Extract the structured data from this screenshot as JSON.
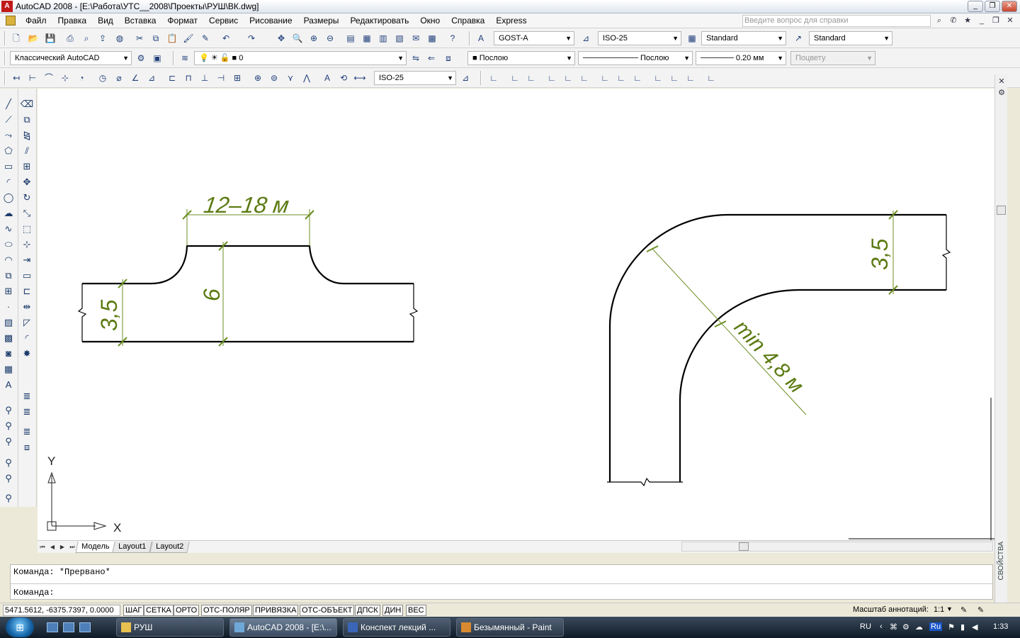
{
  "window": {
    "app_icon": "A",
    "title": "AutoCAD 2008 - [E:\\Работа\\УТС__2008\\Проекты\\РУШ\\ВК.dwg]",
    "controls": [
      "minimize-icon",
      "restore-icon",
      "close-icon"
    ]
  },
  "menubar": {
    "items": [
      "Файл",
      "Правка",
      "Вид",
      "Вставка",
      "Формат",
      "Сервис",
      "Рисование",
      "Размеры",
      "Редактировать",
      "Окно",
      "Справка",
      "Express"
    ],
    "help_placeholder": "Введите вопрос для справки"
  },
  "toolbar_styles": {
    "text_style": "GOST-A",
    "dim_style": "ISO-25",
    "table_style": "Standard",
    "mleader_style": "Standard"
  },
  "toolbar_layers": {
    "workspace": "Классический AutoCAD",
    "layer": "0",
    "color": "Послою",
    "linetype": "Послою",
    "lineweight": "0.20 мм",
    "plotstyle": "Поцвету"
  },
  "toolbar_dims": {
    "dim_style": "ISO-25"
  },
  "drawing": {
    "ucs_y": "Y",
    "ucs_x": "X",
    "left_part": {
      "dim_top": "12–18 м",
      "dim_left": "3,5",
      "dim_middle": "6"
    },
    "right_part": {
      "dim_right": "3,5",
      "dim_radius": "min 4,8 м"
    },
    "colors": {
      "geometry": "#000000",
      "dimension": "#6b8e23",
      "dimension_text": "#5c7a12"
    }
  },
  "tabs": {
    "items": [
      "Модель",
      "Layout1",
      "Layout2"
    ],
    "active": "Модель"
  },
  "side_panel": {
    "label": "СВОЙСТВА"
  },
  "command": {
    "history": "Команда: *Прервано*",
    "prompt": "Команда:"
  },
  "statusbar": {
    "coords": "5471.5612, -6375.7397, 0.0000",
    "buttons": [
      "ШАГ",
      "СЕТКА",
      "ОРТО",
      "ОТС-ПОЛЯР",
      "ПРИВЯЗКА",
      "ОТС-ОБЪЕКТ",
      "ДПСК",
      "ДИН",
      "ВЕС"
    ],
    "annotation_label": "Масштаб аннотаций:",
    "annotation_value": "1:1"
  },
  "taskbar": {
    "tasks": [
      "РУШ",
      "AutoCAD 2008 - [E:\\...",
      "Конспект лекций ...",
      "Безымянный - Paint"
    ],
    "active_task": "AutoCAD 2008 - [E:\\...",
    "lang": "RU",
    "lang_badge": "Ru",
    "clock": "1:33"
  }
}
